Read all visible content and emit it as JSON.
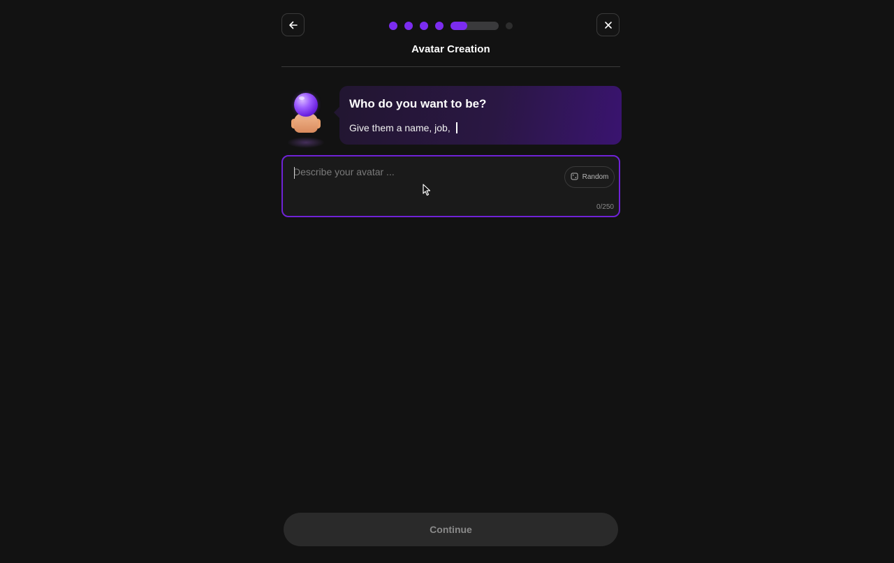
{
  "header": {
    "title": "Avatar Creation",
    "back_icon": "arrow-left-icon",
    "close_icon": "close-icon"
  },
  "progress": {
    "completed_steps": 4,
    "current_step": 5,
    "total_steps": 6,
    "current_step_fill": 0.35,
    "active_color": "#7b2cf0",
    "track_color": "#3a3a3c",
    "inactive_color": "#2d2d2d"
  },
  "assistant": {
    "avatar_icon": "crystal-ball-mascot-icon",
    "question": "Who do you want to be?",
    "typing_text": "Give them a name, job,"
  },
  "prompt_input": {
    "placeholder": "Describe your avatar ...",
    "value": "",
    "random_label": "Random",
    "random_icon": "dice-icon",
    "counter": "0/250",
    "border_color": "#6f22d6"
  },
  "footer": {
    "continue_label": "Continue"
  },
  "colors": {
    "background": "#121212",
    "accent": "#7b2cf0"
  }
}
